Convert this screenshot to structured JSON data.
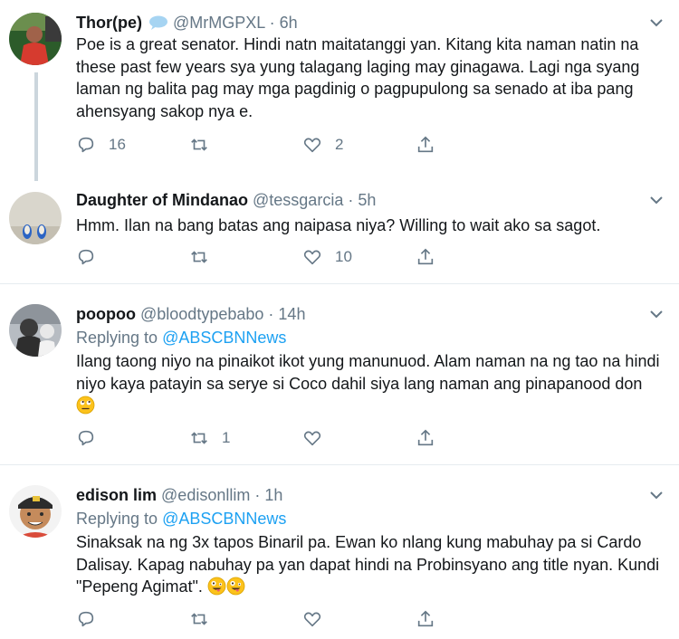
{
  "tweets": [
    {
      "name": "Thor(pe)",
      "handle": "@MrMGPXL",
      "sep": "·",
      "time": "6h",
      "text": "Poe is a great senator. Hindi natn maitatanggi yan. Kitang kita naman natin na these past few years sya yung talagang laging may ginagawa. Lagi nga syang laman ng balita pag may mga pagdinig o pagpupulong sa senado at iba pang ahensyang sakop nya e.",
      "reply_count": "16",
      "retweet_count": "",
      "like_count": "2"
    },
    {
      "name": "Daughter of Mindanao",
      "handle": "@tessgarcia",
      "sep": "·",
      "time": "5h",
      "text": "Hmm. Ilan na bang batas ang naipasa niya? Willing to wait ako sa sagot.",
      "reply_count": "",
      "retweet_count": "",
      "like_count": "10"
    },
    {
      "name": "poopoo",
      "handle": "@bloodtypebabo",
      "sep": "·",
      "time": "14h",
      "replying_prefix": "Replying to",
      "replying_to": "@ABSCBNNews",
      "text": "Ilang taong niyo na pinaikot ikot yung manunuod. Alam naman na ng tao na hindi niyo kaya patayin sa serye si Coco dahil siya lang naman ang pinapanood don",
      "reply_count": "",
      "retweet_count": "1",
      "like_count": ""
    },
    {
      "name": "edison lim",
      "handle": "@edisonllim",
      "sep": "·",
      "time": "1h",
      "replying_prefix": "Replying to",
      "replying_to": "@ABSCBNNews",
      "text": "Sinaksak na ng 3x tapos Binaril pa. Ewan ko nlang kung mabuhay pa si Cardo Dalisay. Kapag nabuhay pa yan dapat hindi na Probinsyano ang title nyan. Kundi \"Pepeng Agimat\".",
      "reply_count": "",
      "retweet_count": "",
      "like_count": ""
    }
  ],
  "icons": {
    "reply": "reply-icon",
    "retweet": "retweet-icon",
    "like": "heart-icon",
    "share": "share-icon",
    "menu": "chevron-down-icon",
    "badge": "speech-bubble-icon"
  },
  "colors": {
    "text": "#14171a",
    "muted": "#657786",
    "link": "#1da1f2",
    "divider": "#e6ecf0"
  }
}
